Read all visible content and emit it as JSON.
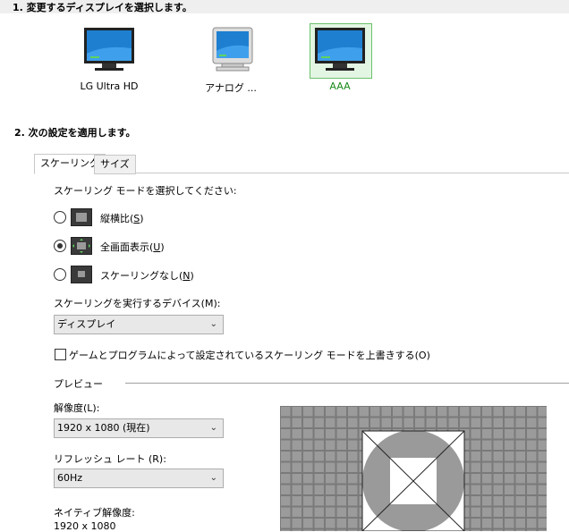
{
  "step1": {
    "title": "1. 変更するディスプレイを選択します。"
  },
  "monitors": [
    {
      "label": "LG Ultra HD",
      "icon": "lcd-monitor-icon",
      "selected": false
    },
    {
      "label": "アナログ ...",
      "icon": "crt-monitor-icon",
      "selected": false
    },
    {
      "label": "AAA",
      "icon": "lcd-monitor-icon",
      "selected": true
    }
  ],
  "step2": {
    "title": "2. 次の設定を適用します。"
  },
  "tabs": [
    {
      "label": "スケーリング",
      "active": true
    },
    {
      "label": "サイズ",
      "active": false
    }
  ],
  "scaling": {
    "mode_prompt": "スケーリング モードを選択してください:",
    "options": [
      {
        "label": "縦横比",
        "hotkey": "S",
        "selected": false
      },
      {
        "label": "全画面表示",
        "hotkey": "U",
        "selected": true
      },
      {
        "label": "スケーリングなし",
        "hotkey": "N",
        "selected": false
      }
    ],
    "device_label": "スケーリングを実行するデバイス(M):",
    "device_value": "ディスプレイ",
    "override_label": "ゲームとプログラムによって設定されているスケーリング モードを上書きする(O)",
    "override_checked": false
  },
  "preview": {
    "label": "プレビュー",
    "resolution_label": "解像度(L):",
    "resolution_value": "1920 x 1080 (現在)",
    "refresh_label": "リフレッシュ レート (R):",
    "refresh_value": "60Hz",
    "native_label": "ネイティブ解像度:",
    "native_value": "1920 x 1080"
  },
  "colors": {
    "selected_border": "#6bc16b",
    "selected_bg": "#e3f6e3",
    "selected_text": "#1a8a1a",
    "screen_blue": "#1e7fd0"
  }
}
